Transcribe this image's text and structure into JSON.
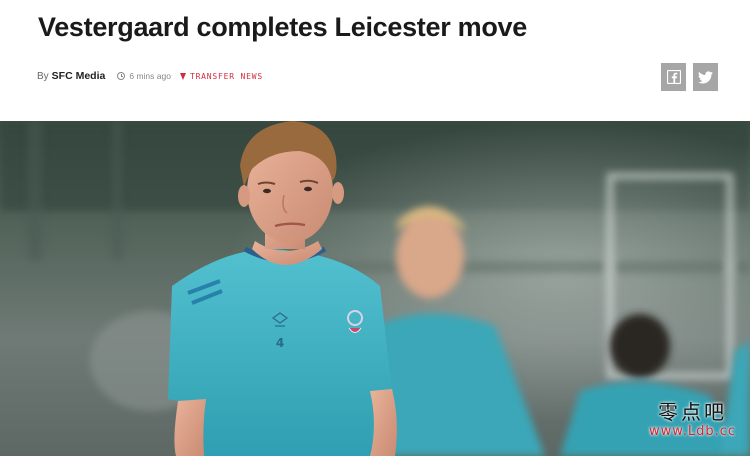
{
  "article": {
    "headline": "Vestergaard completes Leicester move",
    "byline_prefix": "By",
    "author": "SFC Media",
    "time_ago": "6 mins ago",
    "category": "TRANSFER NEWS"
  },
  "share": {
    "icons": [
      "facebook-icon",
      "twitter-icon"
    ]
  },
  "hero": {
    "shirt_number": "4"
  },
  "watermark": {
    "chinese": "零点吧",
    "url": "www.Ldb.cc"
  },
  "colors": {
    "accent_red": "#d42b3f",
    "share_grey": "#a6a6a6",
    "kit_teal": "#3fb3c4"
  }
}
